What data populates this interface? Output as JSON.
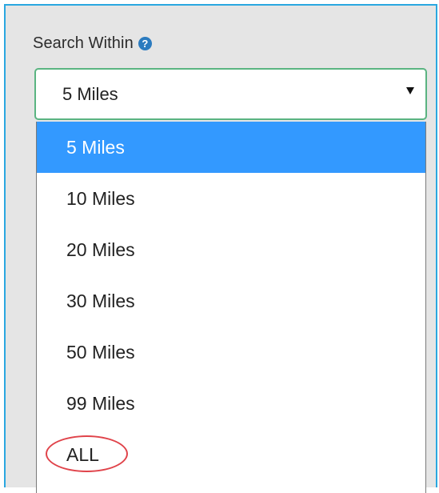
{
  "search_within": {
    "label": "Search Within",
    "help_icon": "question-circle-icon",
    "selected_value": "5 Miles",
    "options": [
      {
        "label": "5 Miles",
        "selected": true
      },
      {
        "label": "10 Miles",
        "selected": false
      },
      {
        "label": "20 Miles",
        "selected": false
      },
      {
        "label": "30 Miles",
        "selected": false
      },
      {
        "label": "50 Miles",
        "selected": false
      },
      {
        "label": "99 Miles",
        "selected": false
      },
      {
        "label": "ALL",
        "selected": false,
        "annotated": true
      }
    ]
  },
  "colors": {
    "panel_border": "#2aa7e0",
    "select_border": "#5ab481",
    "selected_option_bg": "#3399ff",
    "help_icon": "#2b7bbf",
    "annotation_ring": "#e0434a"
  }
}
